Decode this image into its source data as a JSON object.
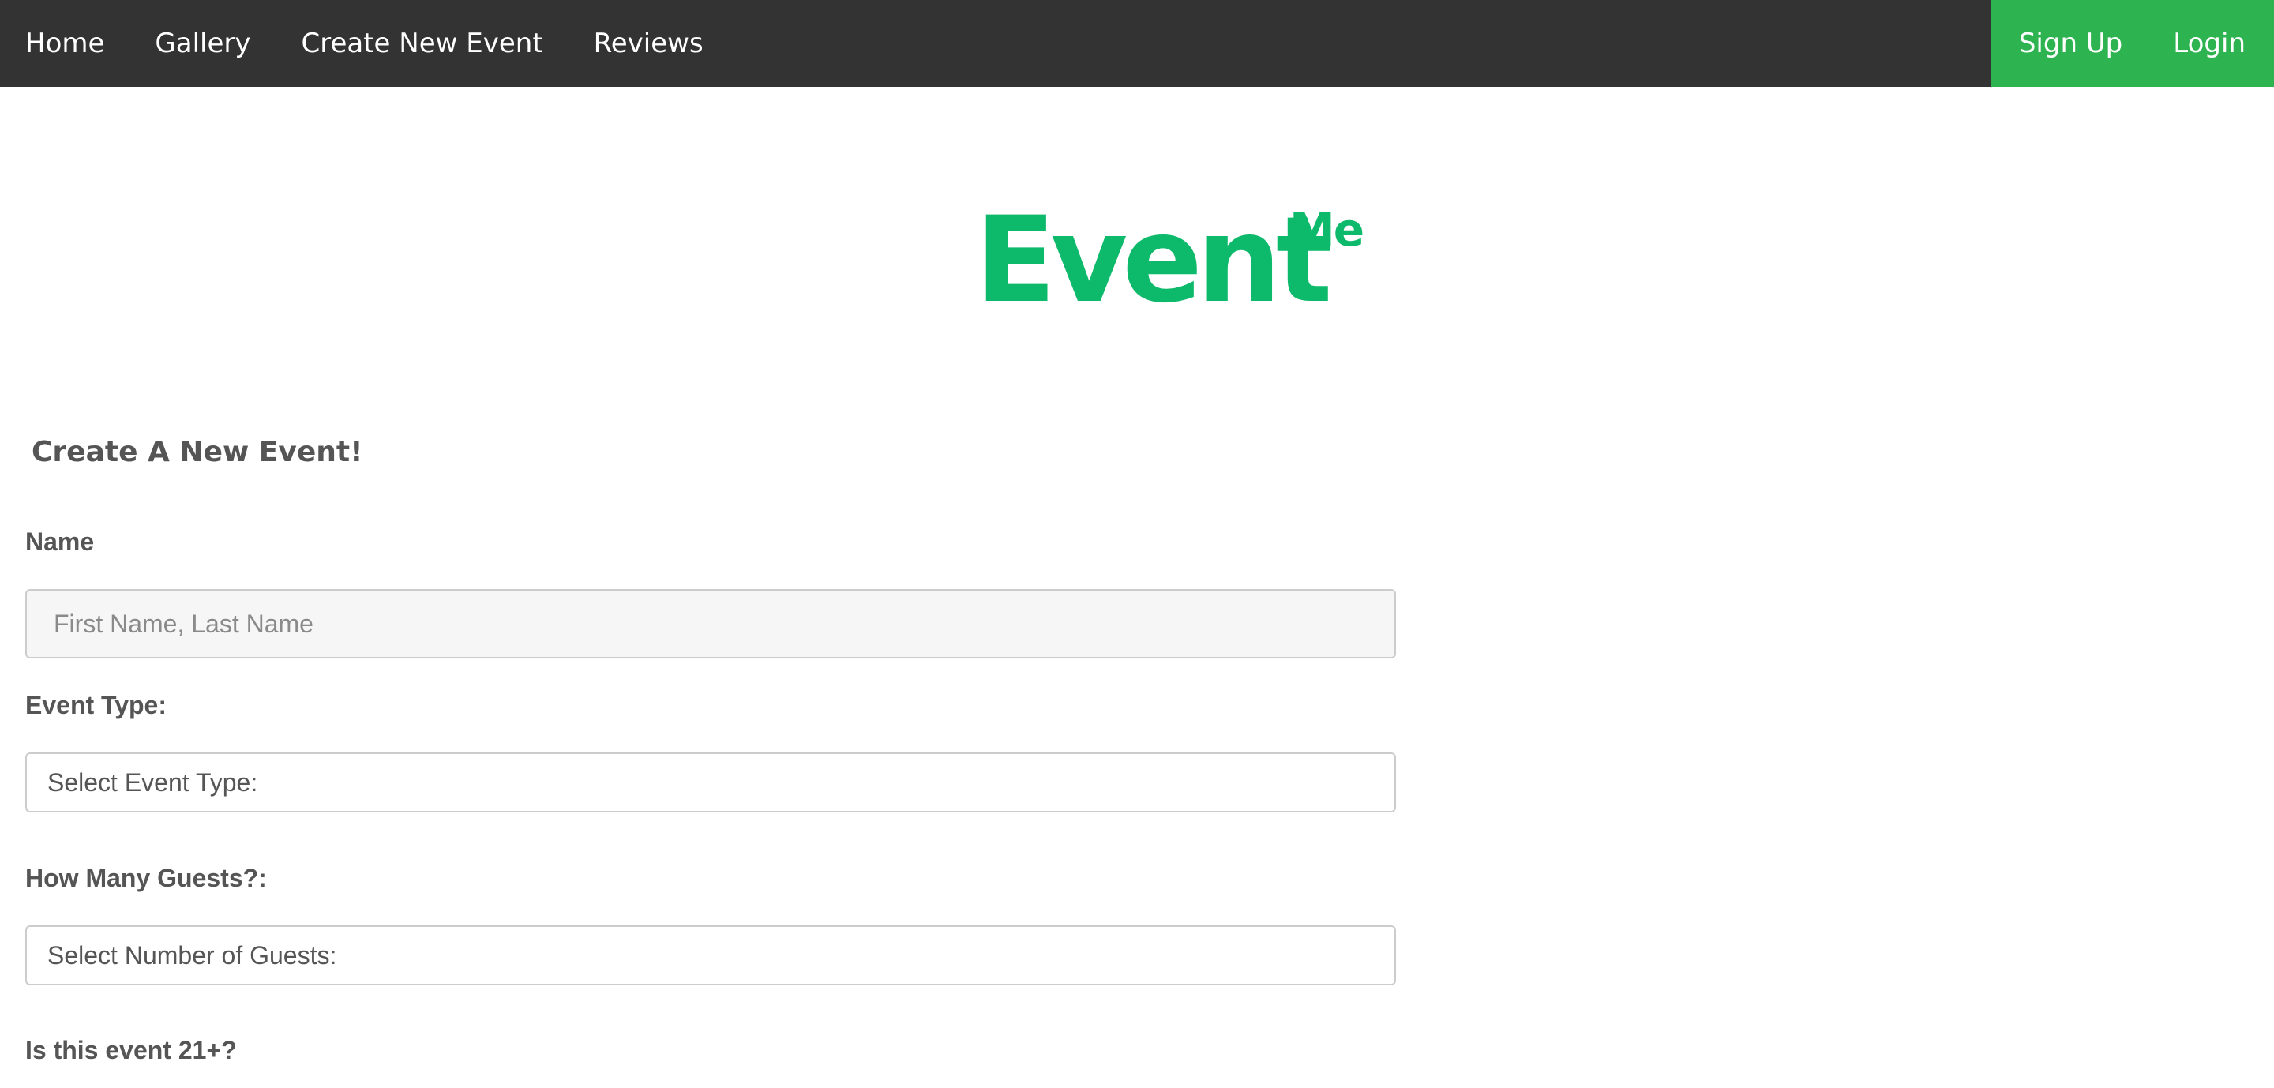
{
  "nav": {
    "left": [
      "Home",
      "Gallery",
      "Create New Event",
      "Reviews"
    ],
    "right": [
      "Sign Up",
      "Login"
    ]
  },
  "logo": {
    "main": "Event",
    "sup": "Me"
  },
  "form": {
    "heading": "Create A New Event!",
    "name_label": "Name",
    "name_placeholder": "First Name, Last Name",
    "event_type_label": "Event Type:",
    "event_type_value": "Select Event Type:",
    "guests_label": "How Many Guests?:",
    "guests_value": "Select Number of Guests:",
    "age_label": "Is this event 21+?"
  },
  "colors": {
    "navbar": "#333333",
    "auth": "#2db350",
    "logo": "#0db96a"
  }
}
